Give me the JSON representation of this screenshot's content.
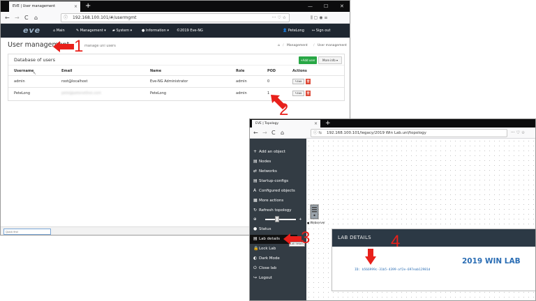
{
  "window1": {
    "tab_title": "EVE | User management",
    "tab_close": "×",
    "new_tab": "+",
    "win_controls": [
      "—",
      "☐",
      "✕"
    ],
    "nav": {
      "back": "←",
      "forward": "→",
      "reload": "C",
      "home": "⌂"
    },
    "url": "192.168.100.101/#/usermgmt",
    "url_icons": "··· ♡ ☆",
    "toolbar_icons": "⫼ ▢ ◉ ≡",
    "logo": "eve",
    "menu": {
      "main": "Main",
      "management": "Management ▾",
      "system": "System ▾",
      "information": "Information ▾",
      "copyright": "©2019 Eve-NG",
      "user": "PeteLong",
      "signout": "Sign out"
    },
    "page_title": "User management",
    "page_subtitle": "manage uni users",
    "breadcrumb": {
      "home": "⌂",
      "management": "Management",
      "sep": "/",
      "current": "User management"
    },
    "panel_title": "Database of users",
    "add_user": "+Add user",
    "more_info": "More info ▾",
    "columns": [
      "Username",
      "Email",
      "Name",
      "Role",
      "POD",
      "Actions"
    ],
    "rows": [
      {
        "username": "admin",
        "email": "root@localhost",
        "name": "Eve-NG Administrator",
        "role": "admin",
        "pod": "0"
      },
      {
        "username": "PeteLong",
        "email": "pete@petenetlive.com",
        "name": "PeteLong",
        "role": "admin",
        "pod": "1"
      }
    ],
    "edit_label": "Edit",
    "delete_label": "🗑",
    "quick_find_placeholder": "Quick find"
  },
  "window2": {
    "tab_title": "EVE | Topology",
    "tab_close": "×",
    "new_tab": "+",
    "nav": {
      "back": "←",
      "forward": "→",
      "reload": "C",
      "home": "⌂"
    },
    "url": "192.168.100.101/legacy/2019 Win Lab.unl/topology",
    "url_icons": "··· ♡ ☆",
    "sidebar": [
      {
        "icon": "+",
        "label": "Add an object"
      },
      {
        "icon": "▤",
        "label": "Nodes"
      },
      {
        "icon": "⇄",
        "label": "Networks"
      },
      {
        "icon": "▤",
        "label": "Startup-configs"
      },
      {
        "icon": "A",
        "label": "Configured objects"
      },
      {
        "icon": "▦",
        "label": "More actions"
      },
      {
        "icon": "↻",
        "label": "Refresh topology"
      },
      {
        "icon": "⊕",
        "label": ""
      },
      {
        "icon": "●",
        "label": "Status"
      },
      {
        "icon": "▤",
        "label": "Lab details"
      },
      {
        "icon": "🔒",
        "label": "Lock Lab"
      },
      {
        "icon": "◐",
        "label": "Dark Mode"
      },
      {
        "icon": "⏻",
        "label": "Close lab"
      },
      {
        "icon": "↪",
        "label": "Logout"
      }
    ],
    "zoom_minus": "⊕",
    "zoom_plus": "+",
    "tooltip": "Lab details",
    "server_name": "Webserver",
    "lab_details_title": "LAB DETAILS",
    "lab_name": "2019 WIN LAB",
    "lab_id": "ID: b566999c-31b5-4399-af2e-697eab12981d"
  },
  "annotations": [
    "1",
    "2",
    "3",
    "4"
  ],
  "colors": {
    "annotation": "#e8201b",
    "navbar": "#1f2731",
    "sidebar": "#333c44",
    "lab_blue": "#2a6db4"
  }
}
